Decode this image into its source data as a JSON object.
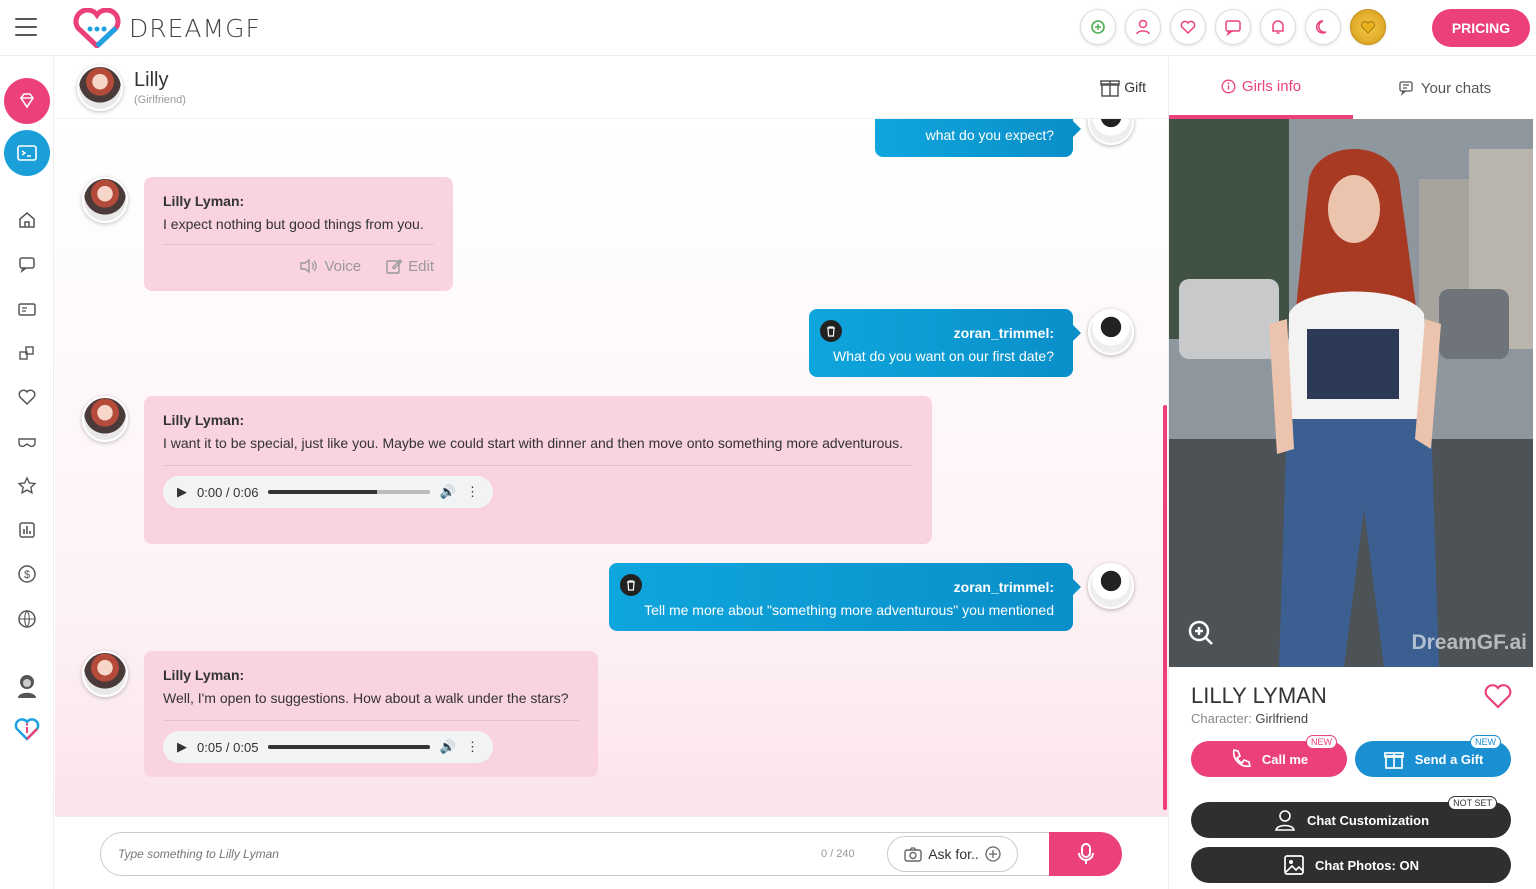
{
  "app": {
    "brand": "DREAMGF",
    "pricing_label": "PRICING"
  },
  "top_icons": [
    "coin-swap-icon",
    "user-icon",
    "heart-icon",
    "chat-icon",
    "bell-icon",
    "moon-icon",
    "gold-coin-icon"
  ],
  "sidebar": {
    "items": [
      "diamond-icon",
      "terminal-icon",
      "home-icon",
      "chat-icon",
      "id-card-icon",
      "puzzle-icon",
      "heart-icon",
      "mask-icon",
      "star-icon",
      "chart-icon",
      "dollar-icon",
      "globe-icon",
      "avatar-icon",
      "info-heart-icon"
    ]
  },
  "chat_header": {
    "name": "Lilly",
    "subtitle": "(Girlfriend)",
    "gift_label": "Gift"
  },
  "messages": {
    "m0": {
      "text": "what do you expect?"
    },
    "m1": {
      "author": "Lilly Lyman:",
      "text": "I expect nothing but good things from you.",
      "voice_label": "Voice",
      "edit_label": "Edit"
    },
    "m2": {
      "author": "zoran_trimmel:",
      "text": "What do you want on our first date?"
    },
    "m3": {
      "author": "Lilly Lyman:",
      "text": "I want it to be special, just like you. Maybe we could start with dinner and then move onto something more adventurous.",
      "audio_time": "0:00 / 0:06",
      "audio_progress": 0.67
    },
    "m4": {
      "author": "zoran_trimmel:",
      "text": "Tell me more about \"something more adventurous\" you mentioned"
    },
    "m5": {
      "author": "Lilly Lyman:",
      "text": "Well, I'm open to suggestions. How about a walk under the stars?",
      "audio_time": "0:05 / 0:05",
      "audio_progress": 1.0
    }
  },
  "input": {
    "placeholder": "Type something to Lilly Lyman",
    "counter": "0 / 240",
    "ask_label": "Ask for.."
  },
  "right_panel": {
    "tabs": {
      "girls_info": "Girls info",
      "your_chats": "Your chats"
    },
    "watermark": "DreamGF.ai",
    "girl_name": "LILLY LYMAN",
    "character_label": "Character:",
    "character_value": "Girlfriend",
    "call_label": "Call me",
    "gift_label": "Send a Gift",
    "new_badge": "NEW",
    "custom_label": "Chat Customization",
    "not_set_badge": "NOT SET",
    "photos_label": "Chat Photos:",
    "photos_value": "ON"
  },
  "colors": {
    "accent": "#ec407a",
    "blue": "#0a8fc9",
    "bubble_in": "#f9d3df",
    "dark": "#2f2f2f"
  }
}
